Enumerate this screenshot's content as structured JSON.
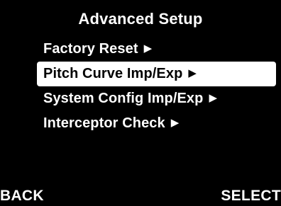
{
  "screen": {
    "title": "Advanced Setup"
  },
  "menu": {
    "arrow_glyph": "▶",
    "items": [
      {
        "label": "Factory Reset",
        "selected": false
      },
      {
        "label": "Pitch Curve Imp/Exp",
        "selected": true
      },
      {
        "label": "System Config Imp/Exp",
        "selected": false
      },
      {
        "label": "Interceptor Check",
        "selected": false
      }
    ]
  },
  "softkeys": {
    "left_label": "BACK",
    "right_label": "SELECT"
  },
  "colors": {
    "background": "#000000",
    "text": "#ffffff",
    "highlight": "#ffffff",
    "highlight_text": "#000000"
  }
}
